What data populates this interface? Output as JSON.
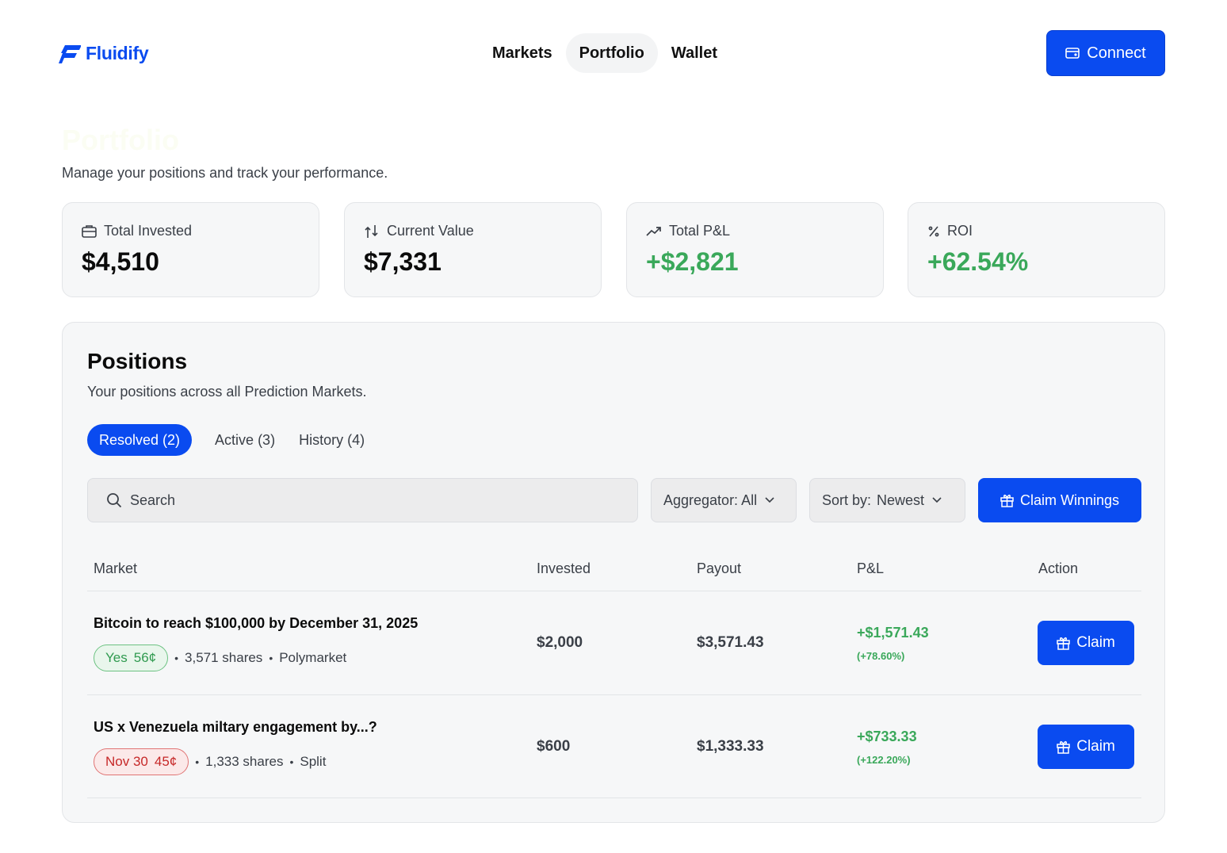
{
  "brand": {
    "name": "Fluidify",
    "color": "#0a4bf0"
  },
  "nav": {
    "items": [
      "Markets",
      "Portfolio",
      "Wallet"
    ],
    "active": "Portfolio"
  },
  "connect": {
    "label": "Connect",
    "icon": "wallet-icon"
  },
  "page": {
    "title": "Portfolio",
    "subtitle": "Manage your positions and track your performance."
  },
  "stats": [
    {
      "label": "Total Invested",
      "value": "$4,510",
      "icon": "briefcase-icon"
    },
    {
      "label": "Current Value",
      "value": "$7,331",
      "icon": "arrows-up-down-icon"
    },
    {
      "label": "Total P&L",
      "value": "+$2,821",
      "icon": "trending-up-icon",
      "color": "#3aa85a"
    },
    {
      "label": "ROI",
      "value": "+62.54%",
      "icon": "percent-icon",
      "color": "#3aa85a"
    }
  ],
  "positions": {
    "title": "Positions",
    "subtitle": "Your positions across all Prediction Markets.",
    "tabs": [
      "Resolved (2)",
      "Active (3)",
      "History (4)"
    ],
    "active_tab": "Resolved (2)",
    "search_placeholder": "Search",
    "aggregator_label": "Aggregator: All",
    "sort_prefix": "Sort by:",
    "sort_value": "Newest",
    "claim_all_label": "Claim Winnings",
    "columns": [
      "Market",
      "Invested",
      "Payout",
      "P&L",
      "Action"
    ],
    "rows": [
      {
        "market": "Bitcoin to reach $100,000 by December 31, 2025",
        "outcome": "Yes",
        "price": "56¢",
        "outcome_color": "green",
        "shares": "3,571 shares",
        "source": "Polymarket",
        "invested": "$2,000",
        "payout": "$3,571.43",
        "pnl": "+$1,571.43",
        "pnl_pct": "(+78.60%)",
        "action": "Claim"
      },
      {
        "market": "US x Venezuela miltary engagement by...?",
        "outcome": "Nov 30",
        "price": "45¢",
        "outcome_color": "red",
        "shares": "1,333 shares",
        "source": "Split",
        "invested": "$600",
        "payout": "$1,333.33",
        "pnl": "+$733.33",
        "pnl_pct": "(+122.20%)",
        "action": "Claim"
      }
    ]
  },
  "colors": {
    "accent": "#0a4bf0",
    "positive": "#3aa85a",
    "negative": "#c62828"
  }
}
